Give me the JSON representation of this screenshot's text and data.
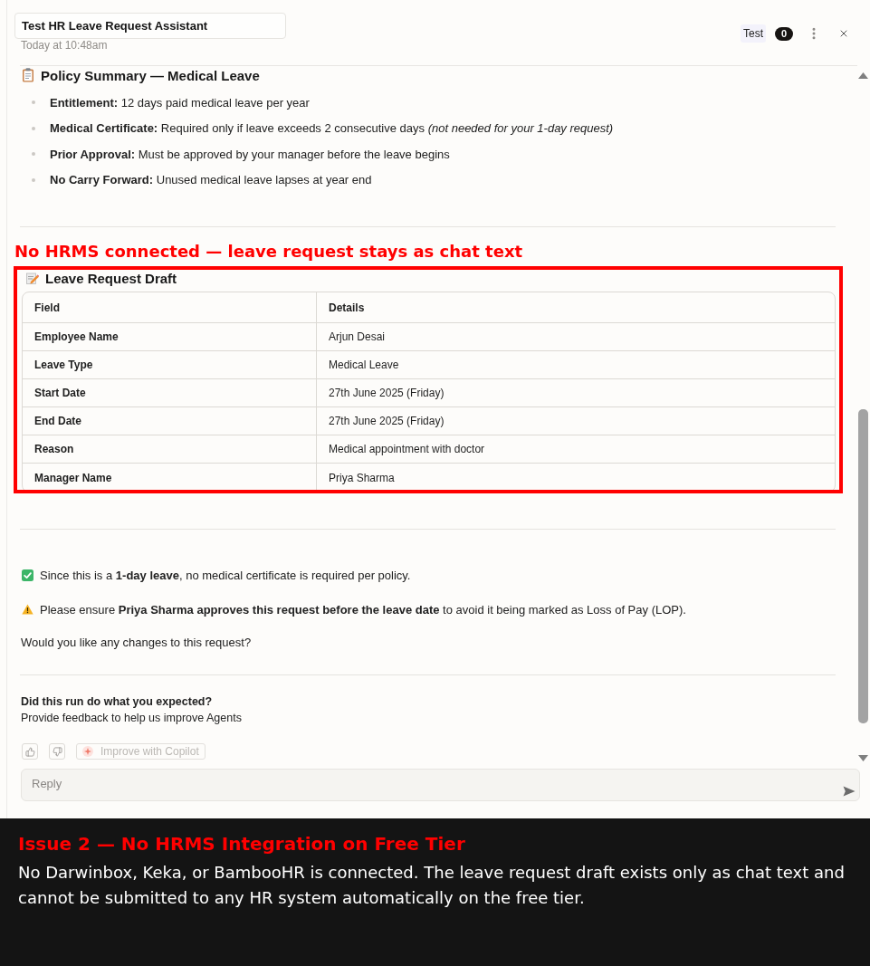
{
  "header": {
    "title": "Test HR Leave Request Assistant",
    "timestamp": "Today at 10:48am",
    "tag": "Test",
    "count": "0"
  },
  "policy_summary": {
    "heading": "Policy Summary — Medical Leave",
    "items": [
      "**Entitlement:** 12 days paid medical leave per year",
      "**Medical Certificate:** Required only if leave exceeds 2 consecutive days *(not needed for your 1-day request)*",
      "**Prior Approval:** Must be approved by your manager before the leave begins",
      "**No Carry Forward:** Unused medical leave lapses at year end"
    ]
  },
  "annotation": "No HRMS connected — leave request stays as chat text",
  "leave_draft": {
    "heading": "Leave Request Draft",
    "columns": [
      "Field",
      "Details"
    ],
    "rows": [
      {
        "field": "Employee Name",
        "details": "Arjun Desai"
      },
      {
        "field": "Leave Type",
        "details": "Medical Leave"
      },
      {
        "field": "Start Date",
        "details": "27th June 2025 (Friday)"
      },
      {
        "field": "End Date",
        "details": "27th June 2025 (Friday)"
      },
      {
        "field": "Reason",
        "details": "Medical appointment with doctor"
      },
      {
        "field": "Manager Name",
        "details": "Priya Sharma"
      }
    ]
  },
  "messages": [
    {
      "kind": "check",
      "text": "Since this is a **1-day leave**, no medical certificate is required per policy."
    },
    {
      "kind": "warning",
      "text": "Please ensure **Priya Sharma approves this request before the leave date** to avoid it being marked as Loss of Pay (LOP)."
    },
    {
      "kind": "plain",
      "text": "Would you like any changes to this request?"
    }
  ],
  "feedback": {
    "question": "Did this run do what you expected?",
    "prompt": "Provide feedback to help us improve Agents",
    "improve_button": {
      "label": "Improve with Copilot",
      "disabled": true
    }
  },
  "reply": {
    "placeholder": "Reply"
  },
  "issue": {
    "title": "Issue 2 — No HRMS Integration on Free Tier",
    "body": "No Darwinbox, Keka, or BambooHR is connected. The leave request draft exists only as chat text and cannot be submitted to any HR system automatically on the free tier."
  }
}
